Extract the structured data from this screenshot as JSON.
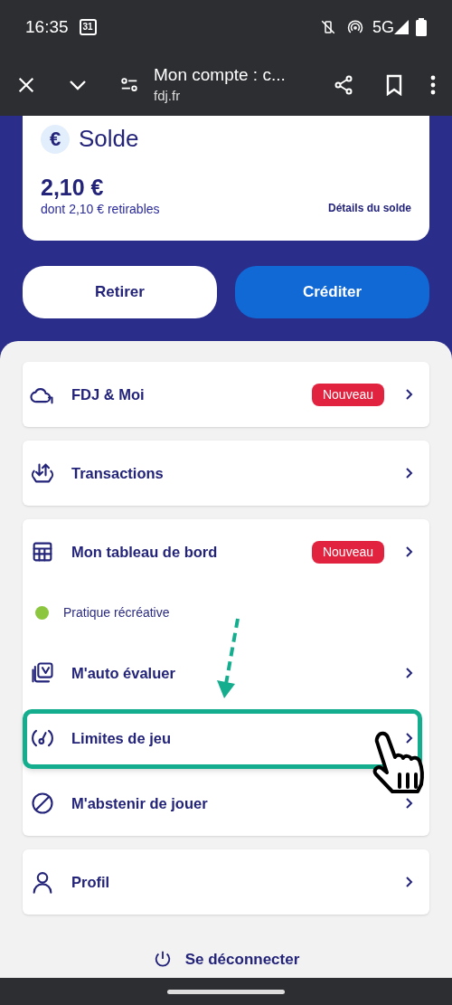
{
  "status_bar": {
    "time": "16:35",
    "calendar_day": "31",
    "network": "5G"
  },
  "browser_bar": {
    "title": "Mon compte : c...",
    "domain": "fdj.fr"
  },
  "balance_card": {
    "title": "Solde",
    "currency_symbol": "€",
    "amount": "2,10 €",
    "withdrawable": "dont 2,10 € retirables",
    "details_link": "Détails du solde"
  },
  "buttons": [
    {
      "label": "Retirer",
      "kind": "secondary"
    },
    {
      "label": "Créditer",
      "kind": "primary"
    }
  ],
  "menu_groups": [
    {
      "items": [
        {
          "kind": "row",
          "label": "FDJ & Moi",
          "badge": "Nouveau",
          "highlighted": false
        }
      ]
    },
    {
      "items": [
        {
          "kind": "row",
          "label": "Transactions",
          "highlighted": false
        }
      ]
    },
    {
      "items": [
        {
          "kind": "row",
          "label": "Mon tableau de bord",
          "badge": "Nouveau",
          "highlighted": false
        },
        {
          "kind": "status",
          "label": "Pratique récréative",
          "color": "#8cc63f"
        },
        {
          "kind": "row",
          "label": "M'auto évaluer",
          "highlighted": false
        },
        {
          "kind": "row",
          "label": "Limites de jeu",
          "highlighted": true
        },
        {
          "kind": "row",
          "label": "M'abstenir de jouer",
          "highlighted": false
        }
      ]
    },
    {
      "items": [
        {
          "kind": "row",
          "label": "Profil",
          "highlighted": false
        }
      ]
    }
  ],
  "logout": {
    "label": "Se déconnecter"
  }
}
